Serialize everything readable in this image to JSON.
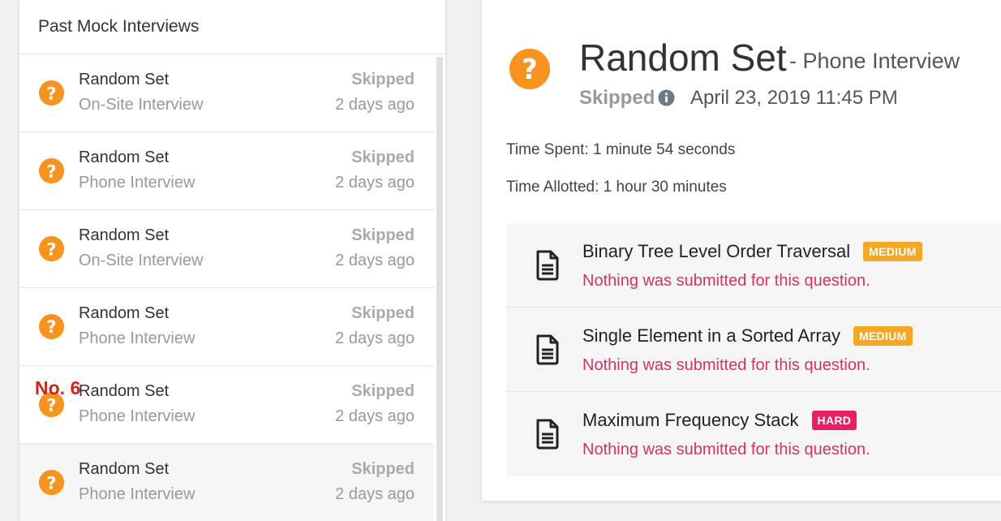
{
  "sidebar": {
    "title": "Past Mock Interviews",
    "items": [
      {
        "title": "Random Set",
        "type": "On-Site Interview",
        "status": "Skipped",
        "time": "2 days ago"
      },
      {
        "title": "Random Set",
        "type": "Phone Interview",
        "status": "Skipped",
        "time": "2 days ago"
      },
      {
        "title": "Random Set",
        "type": "On-Site Interview",
        "status": "Skipped",
        "time": "2 days ago"
      },
      {
        "title": "Random Set",
        "type": "Phone Interview",
        "status": "Skipped",
        "time": "2 days ago"
      },
      {
        "title": "Random Set",
        "type": "Phone Interview",
        "status": "Skipped",
        "time": "2 days ago"
      },
      {
        "title": "Random Set",
        "type": "Phone Interview",
        "status": "Skipped",
        "time": "2 days ago"
      }
    ],
    "annotation": "No. 6"
  },
  "detail": {
    "title": "Random Set",
    "type": "- Phone Interview",
    "status": "Skipped",
    "date": "April 23, 2019 11:45 PM",
    "time_spent": "Time Spent: 1 minute 54 seconds",
    "time_allotted": "Time Allotted: 1 hour 30 minutes",
    "questions": [
      {
        "title": "Binary Tree Level Order Traversal",
        "difficulty": "MEDIUM",
        "message": "Nothing was submitted for this question."
      },
      {
        "title": "Single Element in a Sorted Array",
        "difficulty": "MEDIUM",
        "message": "Nothing was submitted for this question."
      },
      {
        "title": "Maximum Frequency Stack",
        "difficulty": "HARD",
        "message": "Nothing was submitted for this question."
      }
    ]
  },
  "colors": {
    "accent_orange": "#f7931e",
    "medium": "#f5a623",
    "hard": "#e91e63",
    "error_text": "#d73263",
    "annotation": "#d9201b"
  },
  "icons": {
    "status": "question-circle-icon",
    "info": "info-circle-icon",
    "question": "document-icon"
  }
}
